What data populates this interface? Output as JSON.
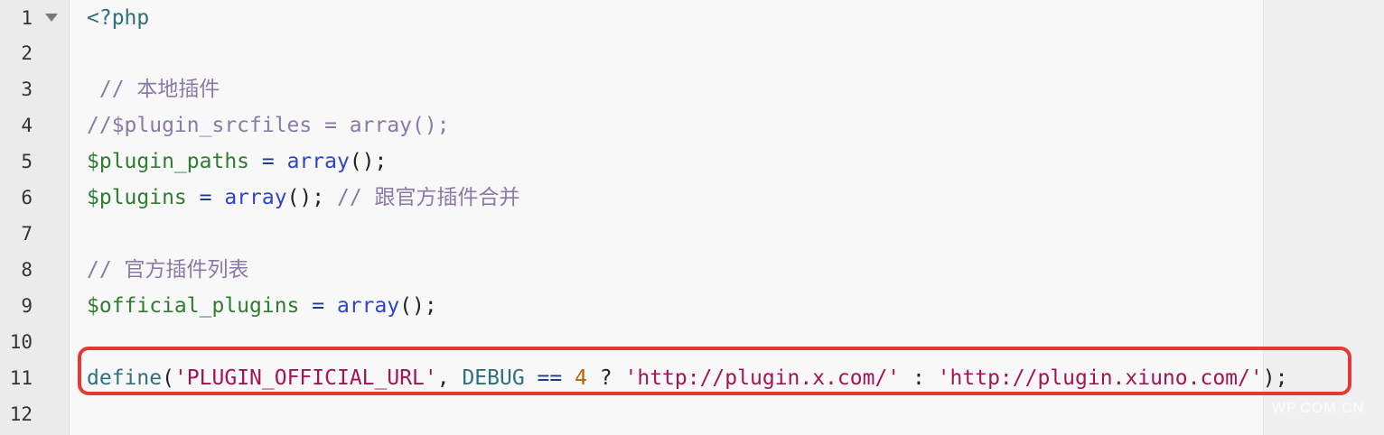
{
  "editor": {
    "lines": [
      {
        "number": "1",
        "tokens": [
          {
            "t": "<?php",
            "c": "tag"
          }
        ]
      },
      {
        "number": "2",
        "tokens": []
      },
      {
        "number": "3",
        "tokens": [
          {
            "t": " // 本地插件",
            "c": "cmt"
          }
        ]
      },
      {
        "number": "4",
        "tokens": [
          {
            "t": "//$plugin_srcfiles = array();",
            "c": "cmt"
          }
        ]
      },
      {
        "number": "5",
        "tokens": [
          {
            "t": "$plugin_paths",
            "c": "var"
          },
          {
            "t": " = ",
            "c": "op"
          },
          {
            "t": "array",
            "c": "fn"
          },
          {
            "t": "();",
            "c": "punc"
          }
        ]
      },
      {
        "number": "6",
        "tokens": [
          {
            "t": "$plugins",
            "c": "var"
          },
          {
            "t": " = ",
            "c": "op"
          },
          {
            "t": "array",
            "c": "fn"
          },
          {
            "t": "(); ",
            "c": "punc"
          },
          {
            "t": "// 跟官方插件合并",
            "c": "cmt"
          }
        ]
      },
      {
        "number": "7",
        "tokens": []
      },
      {
        "number": "8",
        "tokens": [
          {
            "t": "// 官方插件列表",
            "c": "cmt"
          }
        ]
      },
      {
        "number": "9",
        "tokens": [
          {
            "t": "$official_plugins",
            "c": "var"
          },
          {
            "t": " = ",
            "c": "op"
          },
          {
            "t": "array",
            "c": "fn"
          },
          {
            "t": "();",
            "c": "punc"
          }
        ]
      },
      {
        "number": "10",
        "tokens": []
      },
      {
        "number": "11",
        "tokens": [
          {
            "t": "define",
            "c": "const"
          },
          {
            "t": "(",
            "c": "punc"
          },
          {
            "t": "'PLUGIN_OFFICIAL_URL'",
            "c": "str"
          },
          {
            "t": ", ",
            "c": "punc"
          },
          {
            "t": "DEBUG",
            "c": "const"
          },
          {
            "t": " == ",
            "c": "op"
          },
          {
            "t": "4",
            "c": "num"
          },
          {
            "t": " ? ",
            "c": "punc"
          },
          {
            "t": "'http://plugin.x.com/'",
            "c": "str"
          },
          {
            "t": " : ",
            "c": "punc"
          },
          {
            "t": "'http://plugin.xiuno.com/'",
            "c": "str"
          },
          {
            "t": ");",
            "c": "punc"
          }
        ]
      },
      {
        "number": "12",
        "tokens": []
      }
    ],
    "fold_marker_line": "1",
    "highlighted_line": "11",
    "highlight_color": "#e53935"
  },
  "watermark": "WP.COM.CN"
}
